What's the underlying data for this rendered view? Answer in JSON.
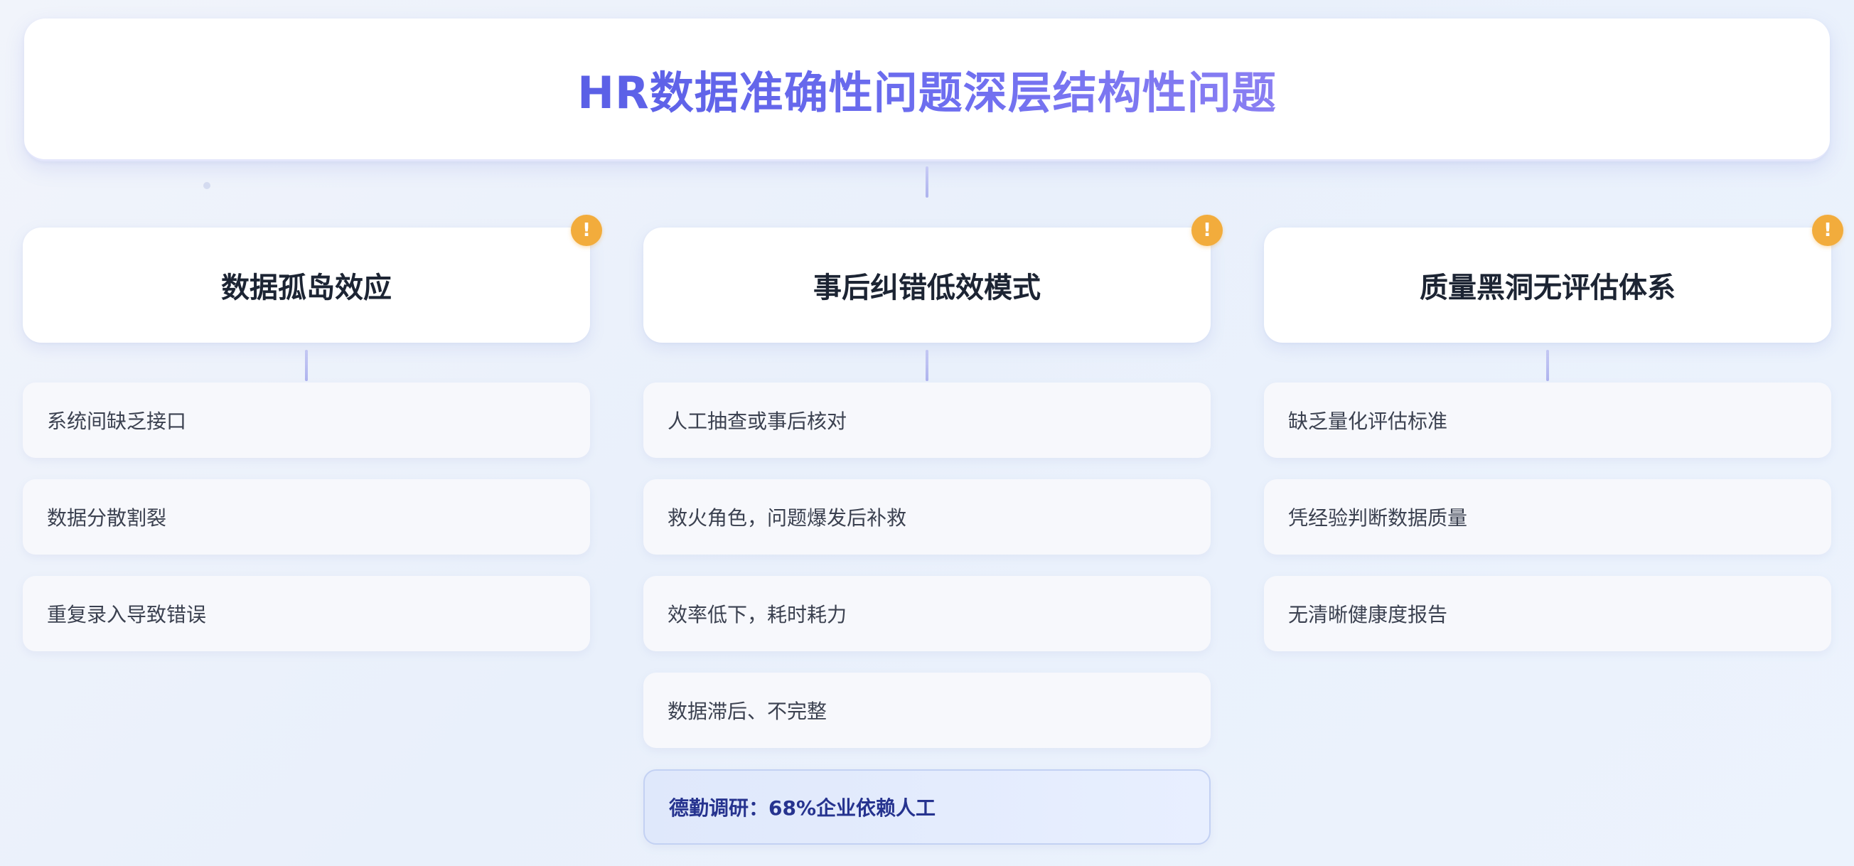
{
  "title": "HR数据准确性问题深层结构性问题",
  "badge_symbol": "!",
  "columns": [
    {
      "heading": "数据孤岛效应",
      "items": [
        "系统间缺乏接口",
        "数据分散割裂",
        "重复录入导致错误"
      ]
    },
    {
      "heading": "事后纠错低效模式",
      "items": [
        "人工抽查或事后核对",
        "救火角色，问题爆发后补救",
        "效率低下，耗时耗力",
        "数据滞后、不完整"
      ],
      "highlight": "德勤调研：68%企业依赖人工"
    },
    {
      "heading": "质量黑洞无评估体系",
      "items": [
        "缺乏量化评估标准",
        "凭经验判断数据质量",
        "无清晰健康度报告"
      ]
    }
  ],
  "colors": {
    "title_gradient_start": "#5a5fe6",
    "title_gradient_end": "#8a7ff2",
    "badge": "#f2ac3c",
    "highlight_text": "#26338f"
  },
  "icons": {
    "badge": "warning-icon"
  }
}
